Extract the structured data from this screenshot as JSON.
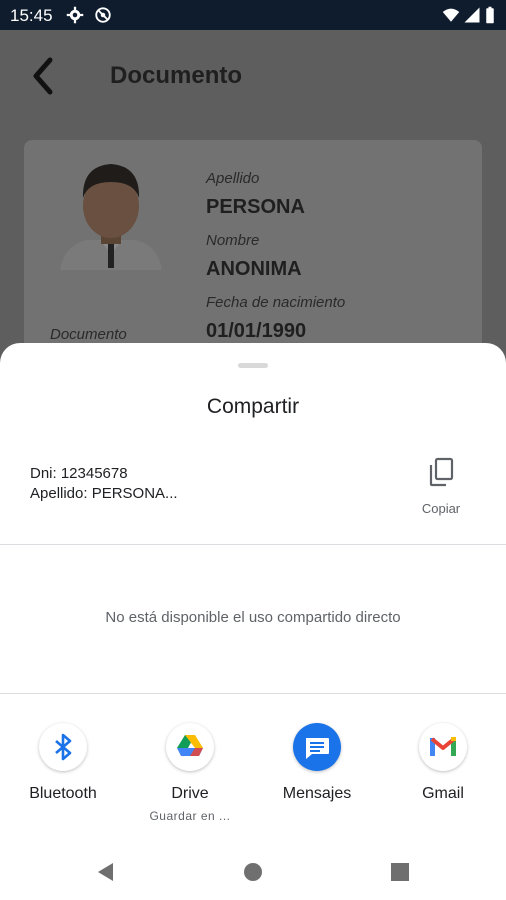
{
  "status_bar": {
    "time": "15:45",
    "left_icons": [
      "gear-icon",
      "no-disturb-icon"
    ],
    "right_icons": [
      "wifi-icon",
      "signal-icon",
      "battery-icon"
    ]
  },
  "app_bar": {
    "title": "Documento",
    "back_icon": "back-arrow-icon"
  },
  "document_card": {
    "photo_label": "Documento",
    "fields": [
      {
        "label": "Apellido",
        "value": "PERSONA"
      },
      {
        "label": "Nombre",
        "value": "ANONIMA"
      },
      {
        "label": "Fecha de nacimiento",
        "value": "01/01/1990"
      }
    ]
  },
  "share_sheet": {
    "title": "Compartir",
    "preview_lines": [
      "Dni: 12345678",
      "Apellido: PERSONA..."
    ],
    "copy_label": "Copiar",
    "no_direct_share": "No está disponible el uso compartido directo",
    "targets": [
      {
        "label": "Bluetooth",
        "sublabel": "",
        "icon": "bluetooth-icon"
      },
      {
        "label": "Drive",
        "sublabel": "Guardar en ...",
        "icon": "drive-icon"
      },
      {
        "label": "Mensajes",
        "sublabel": "",
        "icon": "messages-icon"
      },
      {
        "label": "Gmail",
        "sublabel": "",
        "icon": "gmail-icon"
      }
    ]
  },
  "nav_bar": {
    "icons": [
      "back-triangle-icon",
      "home-circle-icon",
      "recents-square-icon"
    ]
  },
  "colors": {
    "status_bar": "#0f1c2e",
    "scrim": "#5e5e5e",
    "sheet": "#ffffff",
    "messages_blue": "#1a73e8"
  }
}
